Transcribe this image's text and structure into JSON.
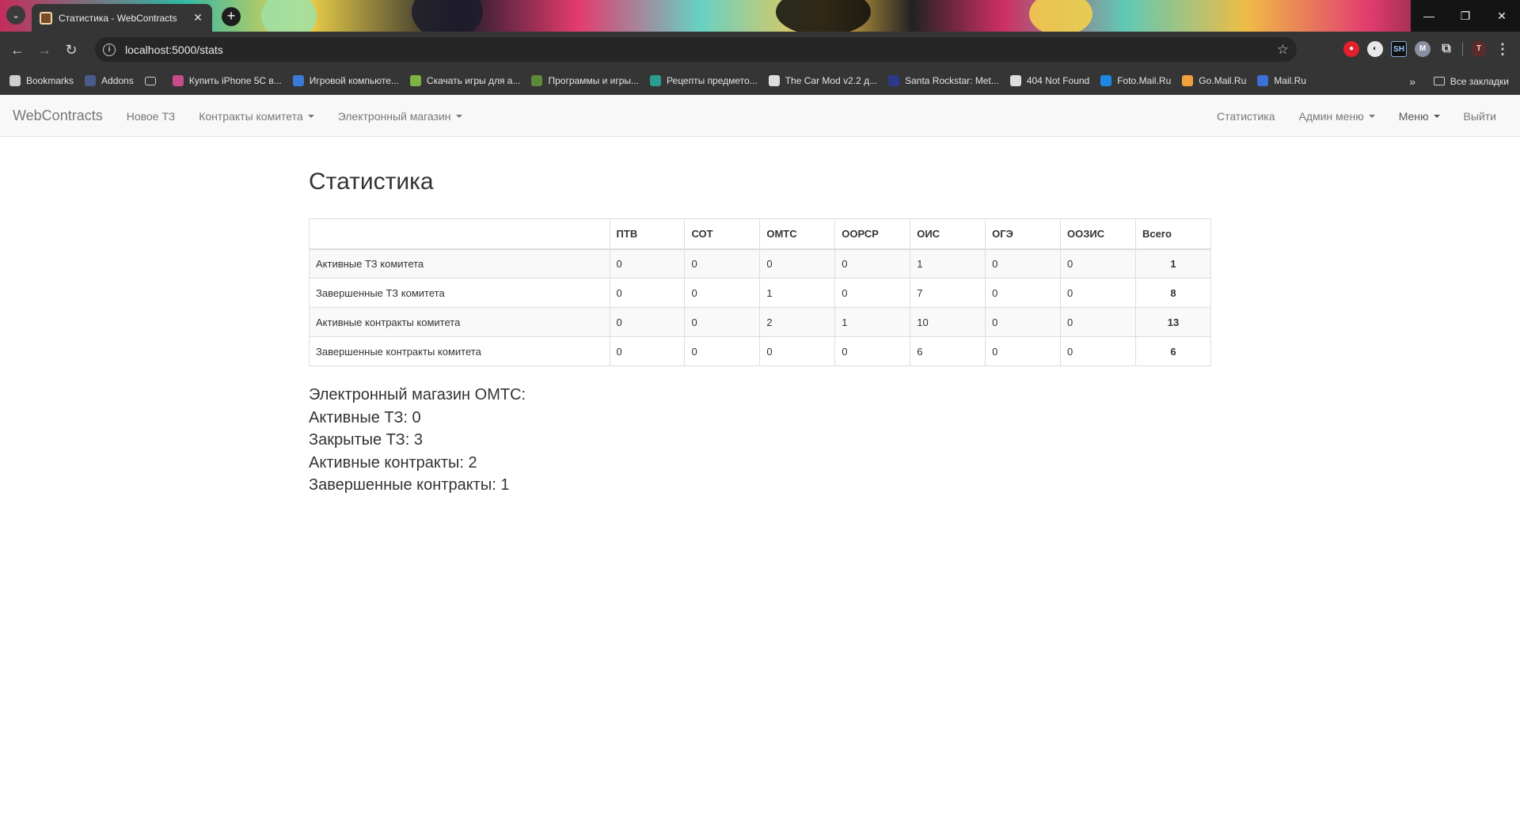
{
  "browser": {
    "tab_title": "Статистика - WebContracts",
    "url": "localhost:5000/stats",
    "bookmarks": [
      {
        "label": "Bookmarks",
        "color": "#cfcfcf"
      },
      {
        "label": "Addons",
        "color": "#4a5a8a"
      },
      {
        "label": "",
        "color": "#cfcfcf"
      },
      {
        "label": "Купить iPhone 5C в...",
        "color": "#c84b8a"
      },
      {
        "label": "Игровой компьюте...",
        "color": "#3a7bd5"
      },
      {
        "label": "Скачать игры для а...",
        "color": "#7cb342"
      },
      {
        "label": "Программы и игры...",
        "color": "#5d8a3a"
      },
      {
        "label": "Рецепты предмето...",
        "color": "#2a9d8f"
      },
      {
        "label": "The Car Mod v2.2 д...",
        "color": "#dddddd"
      },
      {
        "label": "Santa Rockstar: Met...",
        "color": "#2d3a8c"
      },
      {
        "label": "404 Not Found",
        "color": "#dddddd"
      },
      {
        "label": "Foto.Mail.Ru",
        "color": "#1e88e5"
      },
      {
        "label": "Go.Mail.Ru",
        "color": "#f2a03d"
      },
      {
        "label": "Mail.Ru",
        "color": "#3d6fd8"
      }
    ],
    "all_bookmarks": "Все закладки",
    "profile_letter": "T"
  },
  "navbar": {
    "brand": "WebContracts",
    "new_tz": "Новое ТЗ",
    "committee_contracts": "Контракты комитета",
    "eshop": "Электронный магазин",
    "stats": "Статистика",
    "admin_menu": "Админ меню",
    "menu": "Меню",
    "logout": "Выйти"
  },
  "page": {
    "title": "Статистика"
  },
  "table": {
    "headers": [
      "",
      "ПТВ",
      "СОТ",
      "ОМТС",
      "ООРСР",
      "ОИС",
      "ОГЭ",
      "ООЗИС",
      "Всего"
    ],
    "rows": [
      {
        "label": "Активные ТЗ комитета",
        "values": [
          "0",
          "0",
          "0",
          "0",
          "1",
          "0",
          "0"
        ],
        "total": "1"
      },
      {
        "label": "Завершенные ТЗ комитета",
        "values": [
          "0",
          "0",
          "1",
          "0",
          "7",
          "0",
          "0"
        ],
        "total": "8"
      },
      {
        "label": "Активные контракты комитета",
        "values": [
          "0",
          "0",
          "2",
          "1",
          "10",
          "0",
          "0"
        ],
        "total": "13"
      },
      {
        "label": "Завершенные контракты комитета",
        "values": [
          "0",
          "0",
          "0",
          "0",
          "6",
          "0",
          "0"
        ],
        "total": "6"
      }
    ]
  },
  "shop": {
    "heading": "Электронный магазин ОМТС:",
    "active_tz": "Активные ТЗ: 0",
    "closed_tz": "Закрытые ТЗ: 3",
    "active_contracts": "Активные контракты: 2",
    "finished_contracts": "Завершенные контракты: 1"
  }
}
